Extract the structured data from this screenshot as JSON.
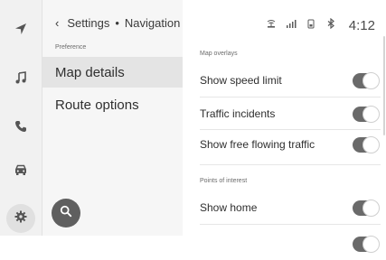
{
  "rail": {
    "items": [
      {
        "icon": "navigation-arrow-icon"
      },
      {
        "icon": "music-note-icon"
      },
      {
        "icon": "phone-icon"
      },
      {
        "icon": "car-icon"
      },
      {
        "icon": "gear-icon",
        "active": true
      }
    ]
  },
  "breadcrumb": {
    "back": "Settings",
    "separator": "•",
    "current": "Navigation"
  },
  "left_section_label": "Preference",
  "menu": [
    {
      "label": "Map details",
      "selected": true
    },
    {
      "label": "Route options",
      "selected": false
    }
  ],
  "status": {
    "time": "4:12"
  },
  "sections": [
    {
      "label": "Map overlays",
      "rows": [
        {
          "label": "Show speed limit",
          "on": true
        },
        {
          "label": "Traffic incidents",
          "on": true
        },
        {
          "label": "Show free flowing traffic",
          "on": true
        }
      ]
    },
    {
      "label": "Points of interest",
      "rows": [
        {
          "label": "Show home",
          "on": true
        }
      ]
    }
  ],
  "colors": {
    "toggle_on": "#6a6a6a",
    "selected_bg": "#e4e4e4",
    "fab": "#5f5f5f"
  }
}
